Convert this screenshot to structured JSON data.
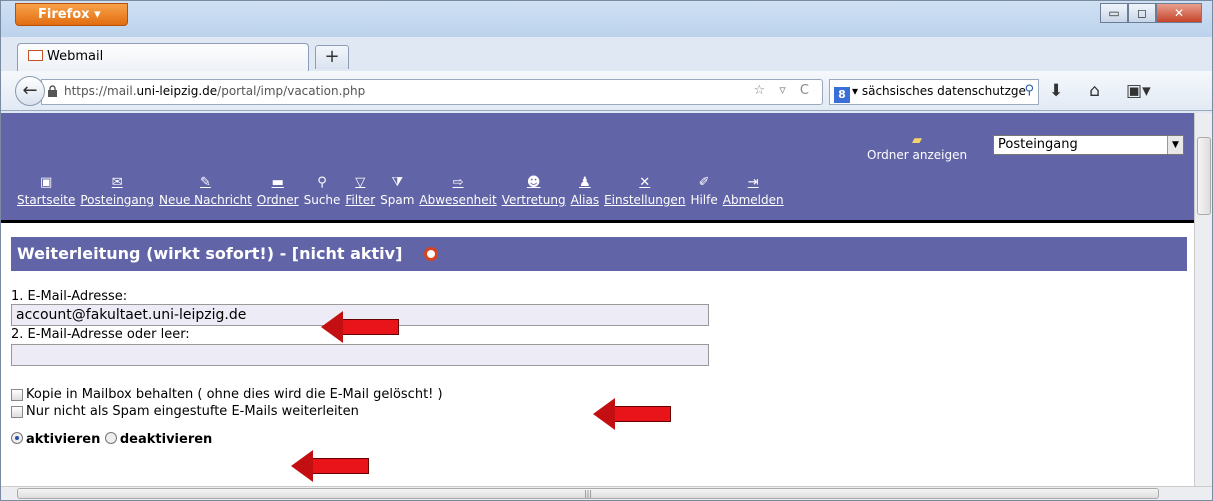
{
  "browser": {
    "app_button": "Firefox ▾",
    "window_controls": {
      "minimize": "▭",
      "maximize": "◻",
      "close": "✕"
    },
    "tab_title": "Webmail",
    "new_tab": "+",
    "back": "←",
    "url_prefix": "https://mail.",
    "url_domain": "uni-leipzig.de",
    "url_path": "/portal/imp/vacation.php",
    "url_icons": "☆ ▿ C",
    "search_engine": "8",
    "search_value": "▾ sächsisches datenschutzge",
    "search_icon": "⚲",
    "nav_icons": {
      "download": "⬇",
      "home": "⌂",
      "menu": "▣▾"
    }
  },
  "header": {
    "folder_label": "Ordner anzeigen",
    "folder_select": "Posteingang",
    "toolbar": [
      {
        "label": "Startseite",
        "icon": "home-icon"
      },
      {
        "label": "Posteingang",
        "icon": "inbox-icon"
      },
      {
        "label": "Neue Nachricht",
        "icon": "compose-icon"
      },
      {
        "label": "Ordner",
        "icon": "folder-icon"
      },
      {
        "label": "Suche",
        "icon": "search-icon"
      },
      {
        "label": "Filter",
        "icon": "filter-icon"
      },
      {
        "label": "Spam",
        "icon": "spam-icon"
      },
      {
        "label": "Abwesenheit",
        "icon": "away-icon"
      },
      {
        "label": "Vertretung",
        "icon": "delegate-icon"
      },
      {
        "label": "Alias",
        "icon": "alias-icon"
      },
      {
        "label": "Einstellungen",
        "icon": "settings-icon"
      },
      {
        "label": "Hilfe",
        "icon": "help-icon"
      },
      {
        "label": "Abmelden",
        "icon": "logout-icon"
      }
    ]
  },
  "section": {
    "title": "Weiterleitung (wirkt sofort!) - [nicht aktiv]"
  },
  "form": {
    "email1_label": "1. E-Mail-Adresse:",
    "email1_value": "account@fakultaet.uni-leipzig.de",
    "email2_label": "2. E-Mail-Adresse oder leer:",
    "email2_value": "",
    "keep_copy_label": "Kopie in Mailbox behalten ( ohne dies wird die E-Mail gelöscht! )",
    "non_spam_label": "Nur nicht als Spam eingestufte E-Mails weiterleiten",
    "activate_label": "aktivieren",
    "deactivate_label": "deaktivieren",
    "activate_selected": true
  },
  "colors": {
    "header_bg": "#6264a8",
    "arrow": "#e8141a",
    "input_bg": "#ecebf6"
  }
}
